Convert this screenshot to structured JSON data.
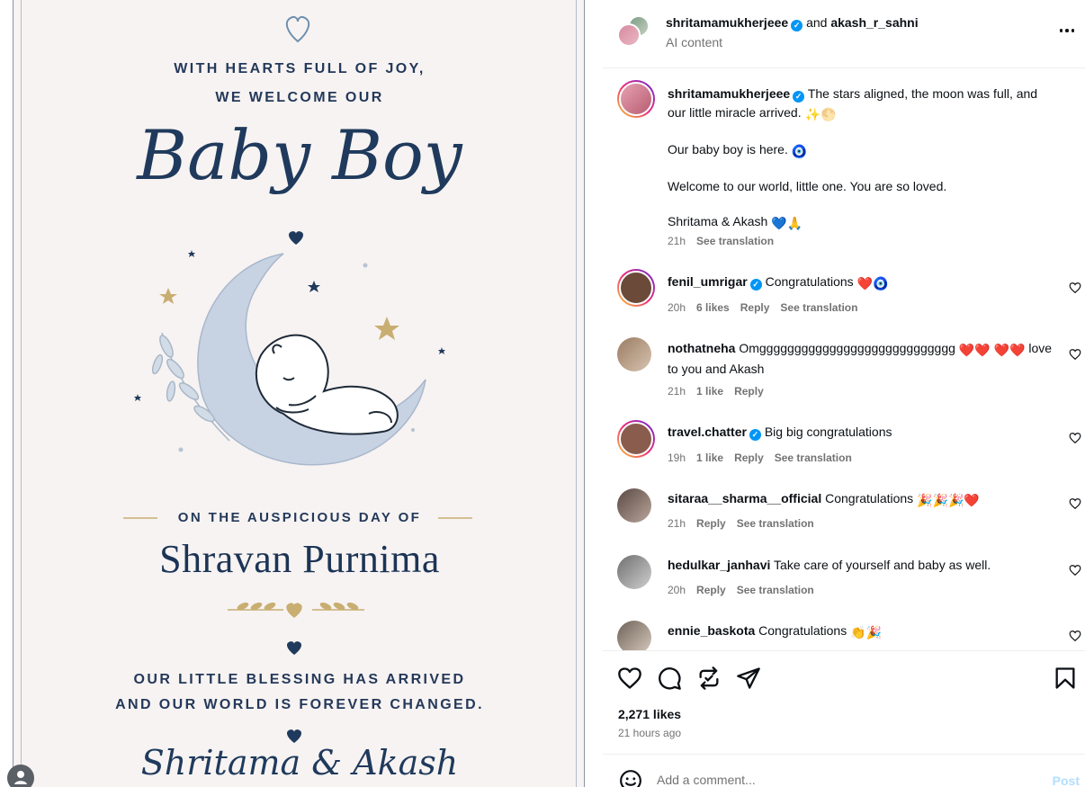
{
  "image": {
    "line1": "WITH HEARTS FULL OF JOY,",
    "line2": "WE WELCOME OUR",
    "headline": "Baby Boy",
    "occasion_line": "ON THE AUSPICIOUS DAY OF",
    "occasion_name": "Shravan Purnima",
    "blessing1": "OUR LITTLE BLESSING HAS ARRIVED",
    "blessing2": "AND OUR WORLD IS FOREVER CHANGED.",
    "signature": "Shritama & Akash",
    "colors": {
      "navy": "#1f3a5c",
      "gold": "#c9ae72",
      "moon": "#c7d3e3",
      "card": "#f7f3f2"
    }
  },
  "header": {
    "author": "shritamamukherjeee",
    "joiner": "and",
    "coauthor": "akash_r_sahni",
    "subtitle": "AI content"
  },
  "caption": {
    "user": "shritamamukherjeee",
    "text1": "The stars aligned, the moon was full, and our little miracle arrived.",
    "text2": "Our baby boy is here.",
    "text3": "Welcome to our world, little one. You are so loved.",
    "text4": "Shritama & Akash",
    "time": "21h",
    "translate": "See translation"
  },
  "comments": [
    {
      "user": "fenil_umrigar",
      "verified": true,
      "text": "Congratulations",
      "time": "20h",
      "likes": "6 likes",
      "reply": "Reply",
      "translate": "See translation",
      "avatar_color": "#6b4a3a"
    },
    {
      "user": "nothatneha",
      "verified": false,
      "text": "Omgggggggggggggggggggggggggggg",
      "text_b": "love to you and Akash",
      "time": "21h",
      "likes": "1 like",
      "reply": "Reply",
      "avatar_color": "#9a7b62"
    },
    {
      "user": "travel.chatter",
      "verified": true,
      "text": "Big big congratulations",
      "time": "19h",
      "likes": "1 like",
      "reply": "Reply",
      "translate": "See translation",
      "avatar_color": "#8a5c4e"
    },
    {
      "user": "sitaraa__sharma__official",
      "verified": false,
      "text": "Congratulations",
      "time": "21h",
      "reply": "Reply",
      "translate": "See translation",
      "avatar_color": "#5a4a44"
    },
    {
      "user": "hedulkar_janhavi",
      "verified": false,
      "text": "Take care of yourself and baby as well.",
      "time": "20h",
      "reply": "Reply",
      "translate": "See translation",
      "avatar_color": "#7f7f7f"
    },
    {
      "user": "ennie_baskota",
      "verified": false,
      "text": "Congratulations",
      "avatar_color": "#6e6258"
    }
  ],
  "footer": {
    "likes": "2,271 likes",
    "time_ago": "21 hours ago",
    "comment_placeholder": "Add a comment...",
    "post_label": "Post"
  }
}
